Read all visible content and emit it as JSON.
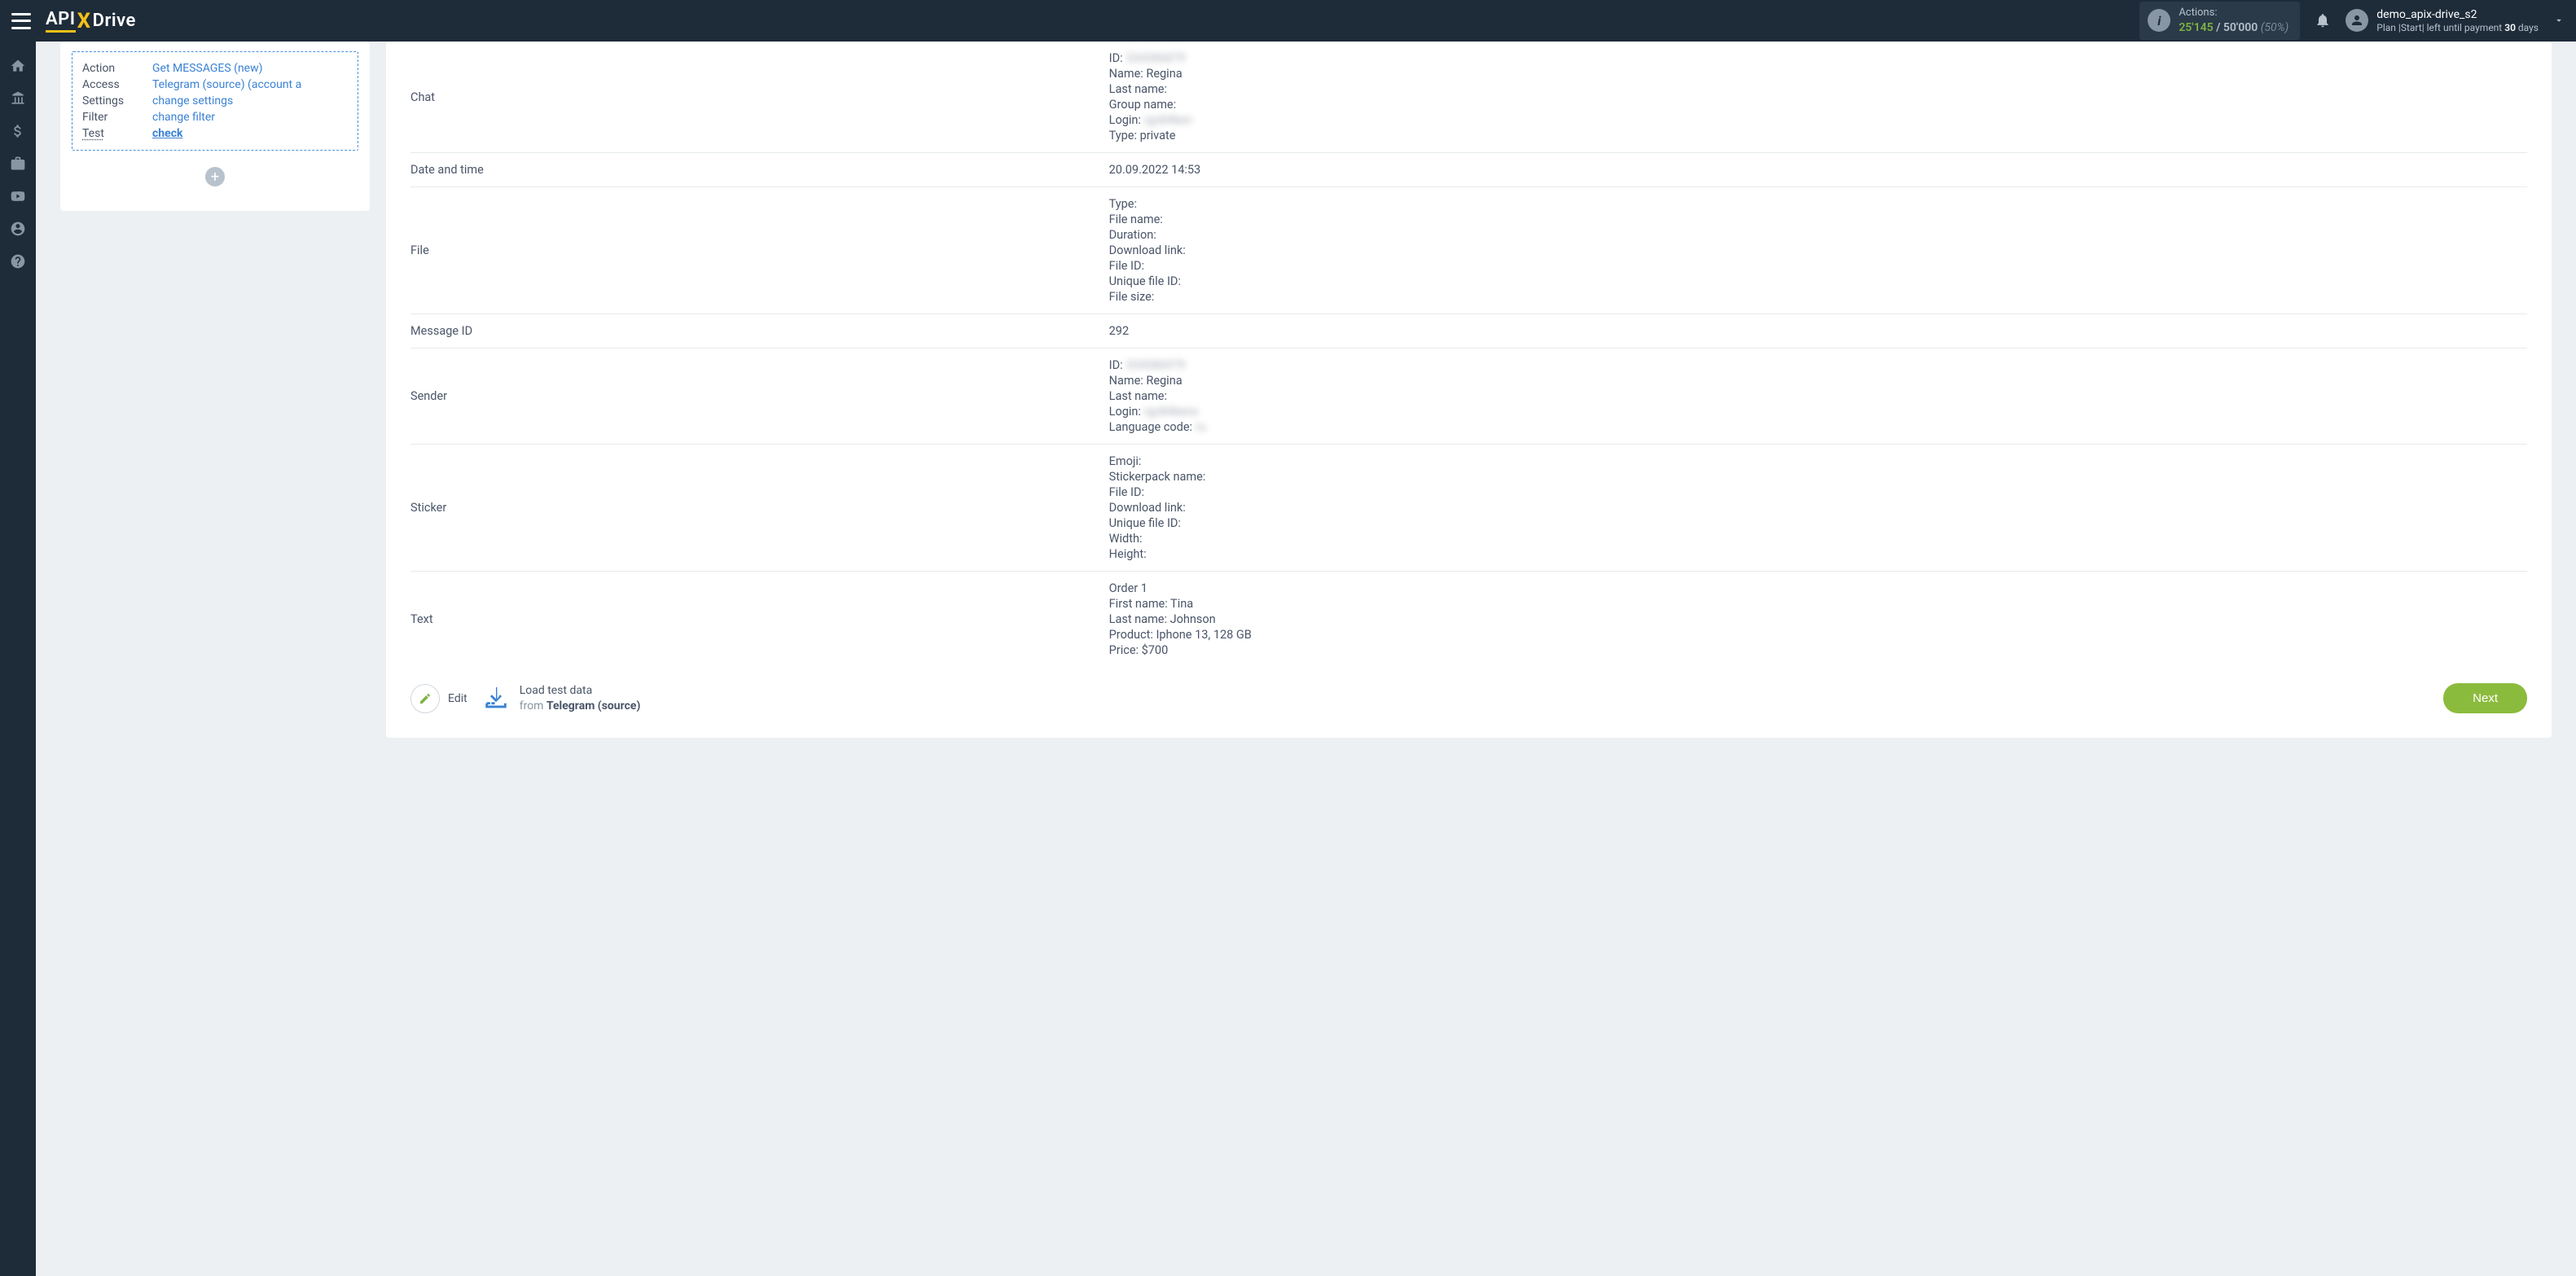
{
  "header": {
    "logo": {
      "prefix": "API",
      "x": "X",
      "suffix": "Drive"
    },
    "actions": {
      "label": "Actions:",
      "used": "25'145",
      "sep": " / ",
      "total": "50'000",
      "pct": "(50%)"
    },
    "user": {
      "name": "demo_apix-drive_s2",
      "plan_prefix": "Plan |Start| left until payment ",
      "plan_days": "30",
      "plan_suffix": " days"
    }
  },
  "config": {
    "rows": [
      {
        "label": "Action",
        "value": "Get MESSAGES (new)",
        "link": true
      },
      {
        "label": "Access",
        "value": "Telegram (source) (account a",
        "link": true
      },
      {
        "label": "Settings",
        "value": "change settings",
        "link": true
      },
      {
        "label": "Filter",
        "value": "change filter",
        "link": true
      },
      {
        "label": "Test",
        "value": "check",
        "bold": true,
        "underline_label": true
      }
    ]
  },
  "test_data": [
    {
      "field": "Chat",
      "lines": [
        {
          "pre": "ID: ",
          "blur": "334386879"
        },
        {
          "text": "Name: Regina"
        },
        {
          "text": "Last name:"
        },
        {
          "text": "Group name:"
        },
        {
          "pre": "Login: ",
          "blur": "rgx84ken"
        },
        {
          "text": "Type: private"
        }
      ]
    },
    {
      "field": "Date and time",
      "lines": [
        {
          "text": "20.09.2022 14:53"
        }
      ]
    },
    {
      "field": "File",
      "lines": [
        {
          "text": "Type:"
        },
        {
          "text": "File name:"
        },
        {
          "text": "Duration:"
        },
        {
          "text": "Download link:"
        },
        {
          "text": "File ID:"
        },
        {
          "text": "Unique file ID:"
        },
        {
          "text": "File size:"
        }
      ]
    },
    {
      "field": "Message ID",
      "lines": [
        {
          "text": "292"
        }
      ]
    },
    {
      "field": "Sender",
      "lines": [
        {
          "pre": "ID: ",
          "blur": "334586979"
        },
        {
          "text": "Name: Regina"
        },
        {
          "text": "Last name:"
        },
        {
          "pre": "Login: ",
          "blur": "rgx84kens"
        },
        {
          "pre": "Language code: ",
          "blur": "ru"
        }
      ]
    },
    {
      "field": "Sticker",
      "lines": [
        {
          "text": "Emoji:"
        },
        {
          "text": "Stickerpack name:"
        },
        {
          "text": "File ID:"
        },
        {
          "text": "Download link:"
        },
        {
          "text": "Unique file ID:"
        },
        {
          "text": "Width:"
        },
        {
          "text": "Height:"
        }
      ]
    },
    {
      "field": "Text",
      "lines": [
        {
          "text": "Order 1"
        },
        {
          "text": "First name: Tina"
        },
        {
          "text": "Last name: Johnson"
        },
        {
          "text": "Product: Iphone 13, 128 GB"
        },
        {
          "text": "Price: $700"
        }
      ]
    }
  ],
  "footer": {
    "edit_label": "Edit",
    "load_title": "Load test data",
    "load_sub_prefix": "from ",
    "load_sub_bold": "Telegram (source)",
    "next_label": "Next"
  }
}
